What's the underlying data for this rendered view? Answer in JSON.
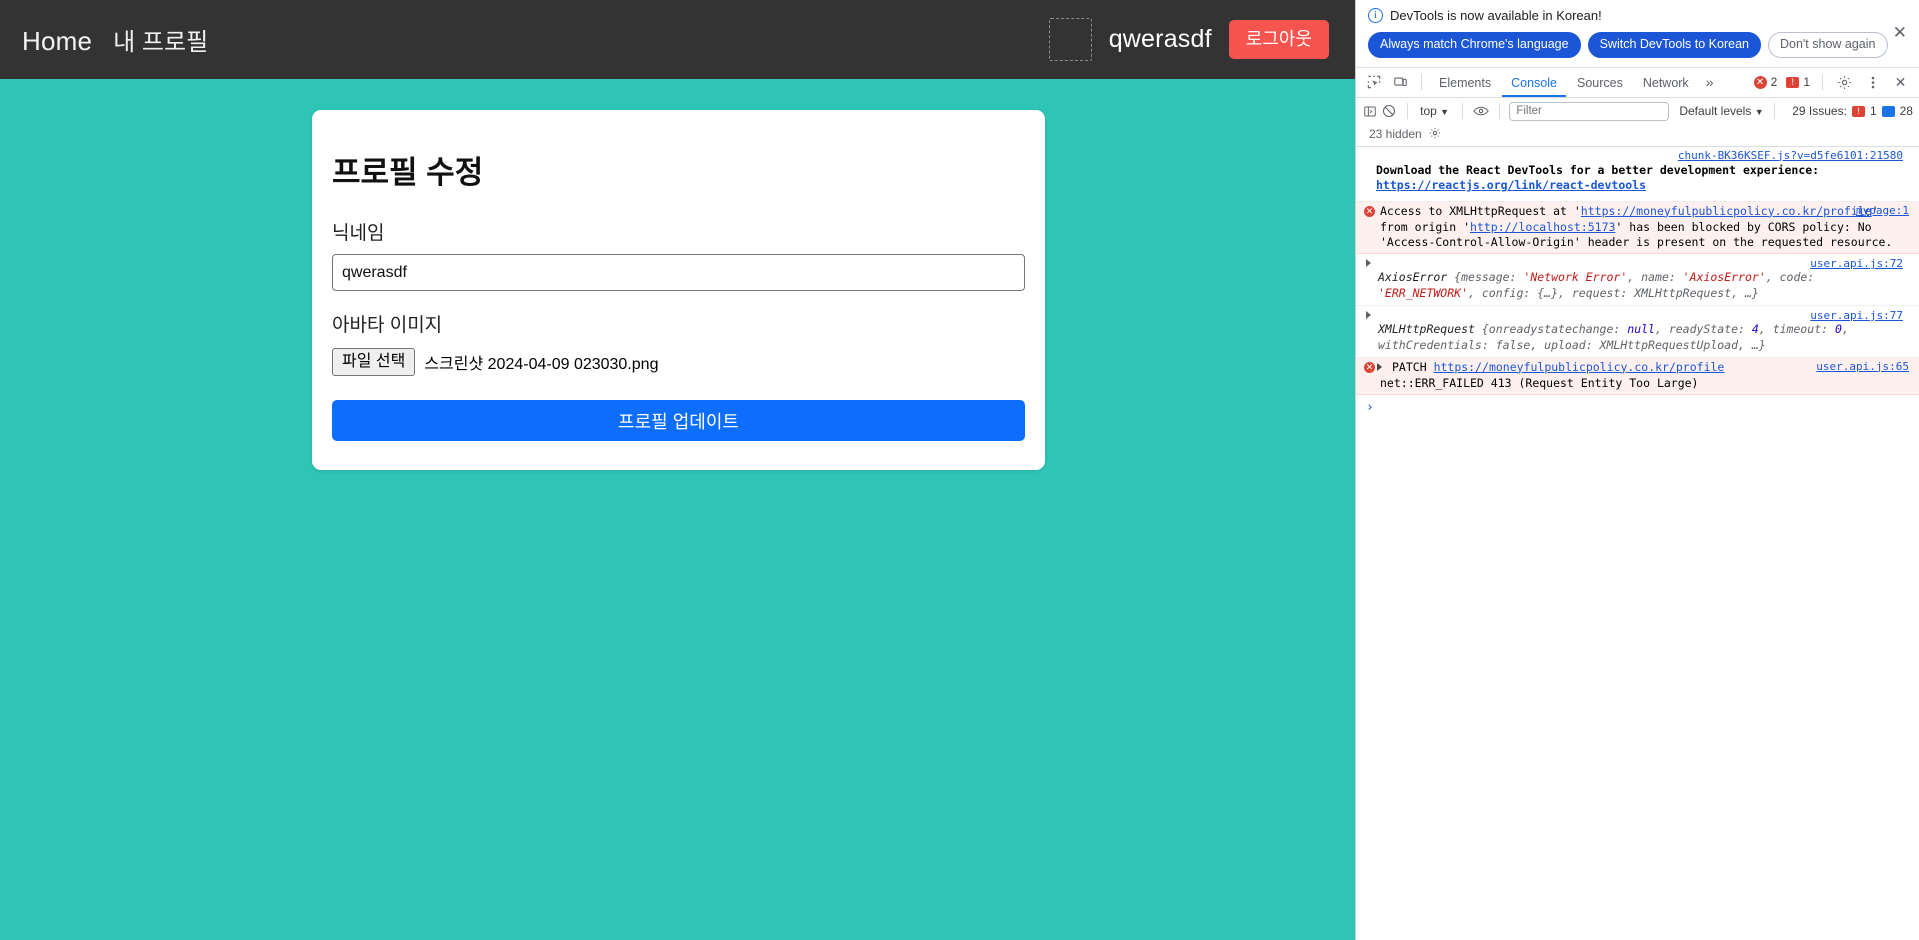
{
  "page": {
    "nav": {
      "home_label": "Home",
      "my_profile_label": "내 프로필",
      "username": "qwerasdf",
      "logout_label": "로그아웃",
      "avatar_icon": "broken-image-icon",
      "bg_color": "#333333"
    },
    "background_color": "#2EC4B6",
    "card": {
      "title": "프로필 수정",
      "nickname_label": "닉네임",
      "nickname_value": "qwerasdf",
      "nickname_placeholder": "",
      "avatar_label": "아바타 이미지",
      "file_button_label": "파일 선택",
      "file_name": "스크린샷 2024-04-09 023030.png",
      "submit_label": "프로필 업데이트",
      "accent_color": "#0d6efd"
    }
  },
  "devtools": {
    "banner": {
      "info_icon": "info-icon",
      "message": "DevTools is now available in Korean!",
      "buttons": [
        {
          "label": "Always match Chrome's language",
          "style": "primary"
        },
        {
          "label": "Switch DevTools to Korean",
          "style": "primary"
        },
        {
          "label": "Don't show again",
          "style": "ghost"
        }
      ],
      "close_icon": "close-icon",
      "close_glyph": "✕"
    },
    "tabbar": {
      "inspect_icon": "inspect-element-icon",
      "device_icon": "device-toolbar-icon",
      "tabs": [
        {
          "label": "Elements",
          "active": false
        },
        {
          "label": "Console",
          "active": true
        },
        {
          "label": "Sources",
          "active": false
        },
        {
          "label": "Network",
          "active": false
        }
      ],
      "more_label": "»",
      "error_count": "2",
      "warning_count": "1",
      "settings_icon": "gear-icon",
      "kebab_icon": "more-vertical-icon",
      "close_icon": "close-icon",
      "close_glyph": "✕"
    },
    "filterbar": {
      "sidebar_icon": "console-sidebar-icon",
      "clear_icon": "clear-console-icon",
      "context_label": "top",
      "context_caret": "▼",
      "eye_icon": "live-expression-icon",
      "filter_placeholder": "Filter",
      "filter_value": "",
      "levels_label": "Default levels",
      "levels_caret": "▼",
      "issues_label": "29 Issues:",
      "issues_error_count": "1",
      "issues_info_count": "28",
      "hidden_label": "23 hidden",
      "hidden_gear_icon": "gear-icon"
    },
    "console_messages": [
      {
        "type": "react-devtools",
        "source": "chunk-BK36KSEF.js?v=d5fe6101:21580",
        "text": "Download the React DevTools for a better development experience:",
        "link": "https://reactjs.org/link/react-devtools"
      },
      {
        "type": "error",
        "source": "mypage:1",
        "icon": "error-icon",
        "prefix": "Access to XMLHttpRequest at '",
        "link1": "https://moneyfulpublicpolicy.co.kr/profile",
        "middle": "' from origin '",
        "link2": "http://localhost:5173",
        "suffix": "' has been blocked by CORS policy: No 'Access-Control-Allow-Origin' header is present on the requested resource."
      },
      {
        "type": "object",
        "source": "user.api.js:72",
        "name": "AxiosError",
        "body_pre": " {message: ",
        "v1": "'Network Error'",
        "k2": ", name: ",
        "v2": "'AxiosError'",
        "k3": ", code: ",
        "v3": "'ERR_NETWORK'",
        "body_post": ", config: {…}, request: XMLHttpRequest, …}"
      },
      {
        "type": "object",
        "source": "user.api.js:77",
        "name": "XMLHttpRequest",
        "body_pre": " {onreadystatechange: ",
        "v1": "null",
        "k2": ", readyState: ",
        "v2": "4",
        "k3": ", timeout: ",
        "v3": "0",
        "body_post": ", withCredentials: false, upload: XMLHttpRequestUpload, …}"
      },
      {
        "type": "network-error",
        "icon": "error-icon",
        "method": "PATCH",
        "url": "https://moneyfulpublicpolicy.co.kr/profile",
        "source": "user.api.js:65",
        "globe_icon": "network-request-icon",
        "detail": "net::ERR_FAILED 413 (Request Entity Too Large)"
      }
    ],
    "prompt_glyph": "›"
  }
}
